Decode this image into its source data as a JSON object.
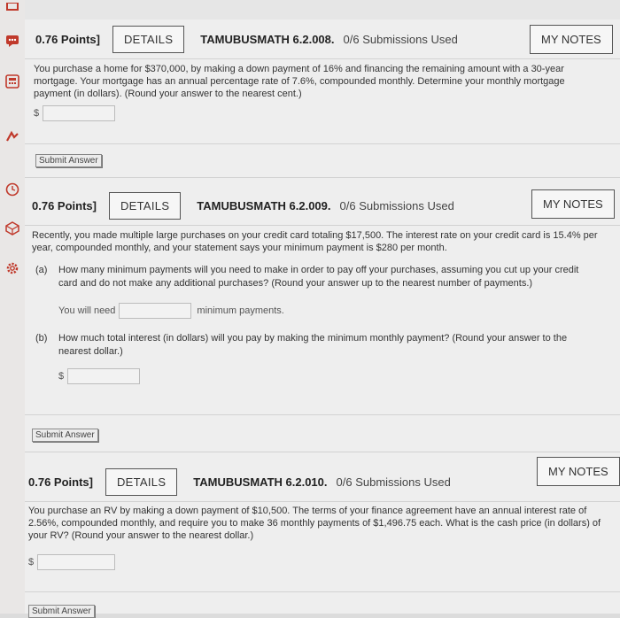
{
  "sidebar": {
    "icons": [
      "bookmark-icon",
      "chat-icon",
      "calculator-icon",
      "graph-icon",
      "clock-icon",
      "cube-icon",
      "gear-icon"
    ]
  },
  "questions": [
    {
      "points": "0.76 Points]",
      "details": "DETAILS",
      "code": "TAMUBUSMATH 6.2.008.",
      "used": "0/6 Submissions Used",
      "notes": "MY NOTES",
      "text": "You purchase a home for $370,000, by making a down payment of 16% and financing the remaining amount with a 30-year mortgage. Your mortgage has an annual percentage rate of 7.6%, compounded monthly. Determine your monthly mortgage payment (in dollars). (Round your answer to the nearest cent.)",
      "prefix": "$",
      "submit": "Submit Answer"
    },
    {
      "points": "0.76 Points]",
      "details": "DETAILS",
      "code": "TAMUBUSMATH 6.2.009.",
      "used": "0/6 Submissions Used",
      "notes": "MY NOTES",
      "text": "Recently, you made multiple large purchases on your credit card totaling $17,500. The interest rate on your credit card is 15.4% per year, compounded monthly, and your statement says your minimum payment is $280 per month.",
      "part_a_label": "(a)",
      "part_a_text": "How many minimum payments will you need to make in order to pay off your purchases, assuming you cut up your credit card and do not make any additional purchases? (Round your answer up to the nearest number of payments.)",
      "part_a_before": "You will need",
      "part_a_after": "minimum payments.",
      "part_b_label": "(b)",
      "part_b_text": "How much total interest (in dollars) will you pay by making the minimum monthly payment? (Round your answer to the nearest dollar.)",
      "prefix": "$",
      "submit": "Submit Answer"
    },
    {
      "points": "0.76 Points]",
      "details": "DETAILS",
      "code": "TAMUBUSMATH 6.2.010.",
      "used": "0/6 Submissions Used",
      "notes": "MY NOTES",
      "text": "You purchase an RV by making a down payment of $10,500. The terms of your finance agreement have an annual interest rate of 2.56%, compounded monthly, and require you to make 36 monthly payments of $1,496.75 each. What is the cash price (in dollars) of your RV? (Round your answer to the nearest dollar.)",
      "prefix": "$",
      "submit": "Submit Answer"
    }
  ]
}
